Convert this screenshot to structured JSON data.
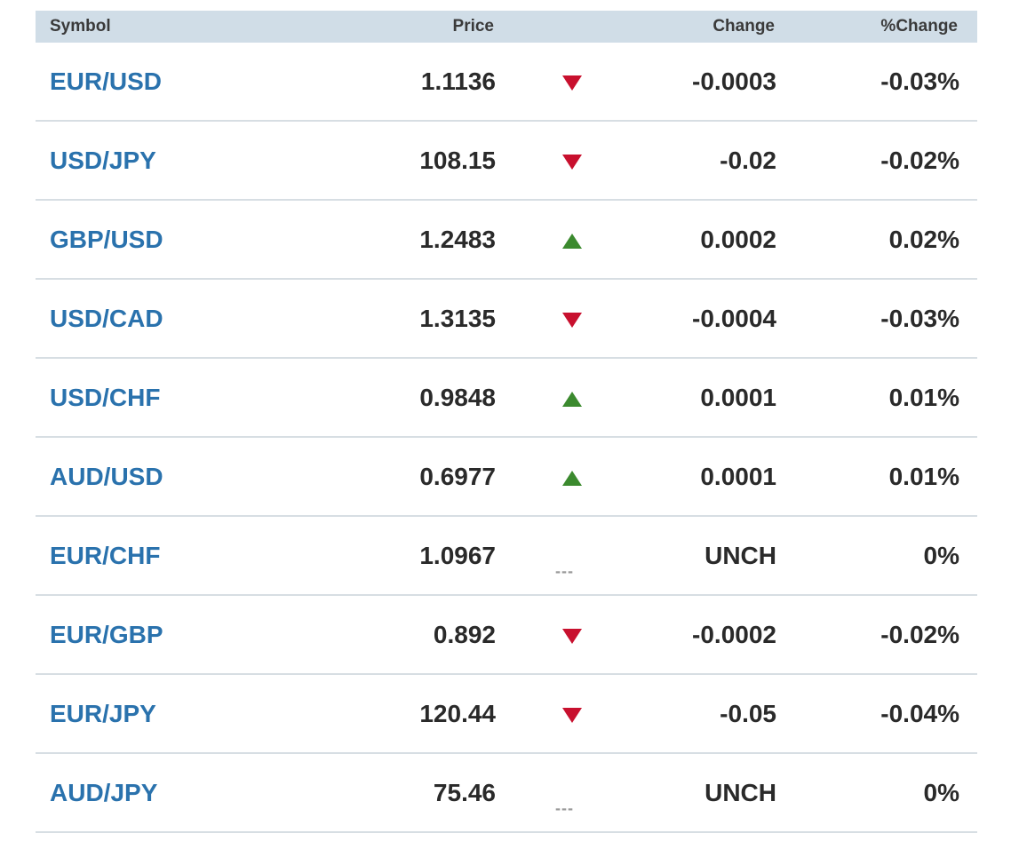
{
  "table": {
    "headers": {
      "symbol": "Symbol",
      "price": "Price",
      "change": "Change",
      "pct_change": "%Change"
    },
    "unch_marker": "---",
    "rows": [
      {
        "symbol": "EUR/USD",
        "price": "1.1136",
        "direction": "down",
        "change": "-0.0003",
        "pct_change": "-0.03%"
      },
      {
        "symbol": "USD/JPY",
        "price": "108.15",
        "direction": "down",
        "change": "-0.02",
        "pct_change": "-0.02%"
      },
      {
        "symbol": "GBP/USD",
        "price": "1.2483",
        "direction": "up",
        "change": "0.0002",
        "pct_change": "0.02%"
      },
      {
        "symbol": "USD/CAD",
        "price": "1.3135",
        "direction": "down",
        "change": "-0.0004",
        "pct_change": "-0.03%"
      },
      {
        "symbol": "USD/CHF",
        "price": "0.9848",
        "direction": "up",
        "change": "0.0001",
        "pct_change": "0.01%"
      },
      {
        "symbol": "AUD/USD",
        "price": "0.6977",
        "direction": "up",
        "change": "0.0001",
        "pct_change": "0.01%"
      },
      {
        "symbol": "EUR/CHF",
        "price": "1.0967",
        "direction": "unch",
        "change": "UNCH",
        "pct_change": "0%"
      },
      {
        "symbol": "EUR/GBP",
        "price": "0.892",
        "direction": "down",
        "change": "-0.0002",
        "pct_change": "-0.02%"
      },
      {
        "symbol": "EUR/JPY",
        "price": "120.44",
        "direction": "down",
        "change": "-0.05",
        "pct_change": "-0.04%"
      },
      {
        "symbol": "AUD/JPY",
        "price": "75.46",
        "direction": "unch",
        "change": "UNCH",
        "pct_change": "0%"
      }
    ]
  },
  "colors": {
    "symbol_link": "#2a72ad",
    "up": "#3b8a2e",
    "down": "#c8102e",
    "unch": "#9a9a9a",
    "header_bg": "#d0dde7"
  }
}
